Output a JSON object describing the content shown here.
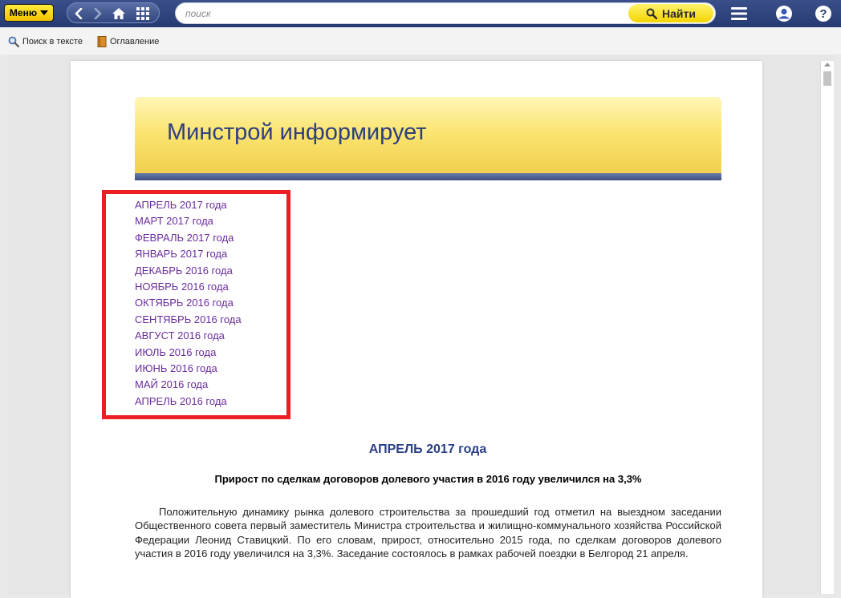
{
  "topbar": {
    "menu_label": "Меню",
    "search_placeholder": "поиск",
    "find_label": "Найти"
  },
  "toolbar": {
    "search_in_text": "Поиск в тексте",
    "contents": "Оглавление"
  },
  "document": {
    "banner_title": "Минстрой информирует",
    "months": [
      "АПРЕЛЬ 2017 года",
      "МАРТ 2017 года",
      "ФЕВРАЛЬ 2017 года",
      "ЯНВАРЬ 2017 года",
      "ДЕКАБРЬ 2016 года",
      "НОЯБРЬ 2016 года",
      "ОКТЯБРЬ 2016 года",
      "СЕНТЯБРЬ 2016 года",
      "АВГУСТ 2016 года",
      "ИЮЛЬ 2016 года",
      "ИЮНЬ 2016 года",
      "МАЙ 2016 года",
      "АПРЕЛЬ 2016 года"
    ],
    "section_heading": "АПРЕЛЬ 2017 года",
    "article_title": "Прирост по сделкам договоров долевого участия в 2016 году увеличился на 3,3%",
    "article_text": "Положительную динамику рынка долевого строительства за прошедший год отметил на выездном заседании Общественного совета первый заместитель Министра строительства и жилищно-коммунального хозяйства Российской Федерации Леонид Ставицкий. По его словам, прирост, относительно 2015 года, по сделкам договоров долевого участия в 2016 году увеличился на 3,3%. Заседание состоялось в рамках рабочей поездки в Белгород 21 апреля."
  },
  "colors": {
    "topbar": "#2f4479",
    "link": "#6a2c9c",
    "heading": "#2a3f87",
    "highlight": "#ee1c25",
    "banner": "#fbe572"
  }
}
